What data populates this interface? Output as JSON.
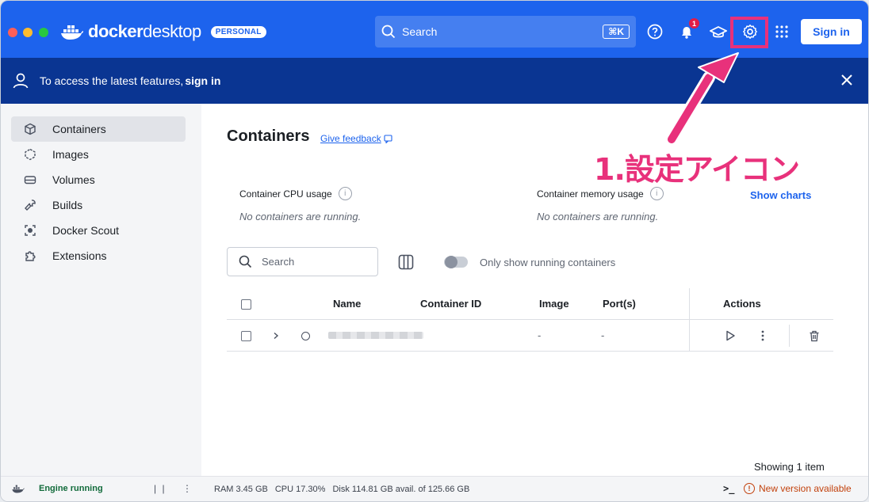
{
  "app": {
    "brand_main": "docker",
    "brand_light": "desktop",
    "plan_badge": "PERSONAL"
  },
  "topbar": {
    "search_placeholder": "Search",
    "search_shortcut": "⌘K",
    "notification_count": "1",
    "sign_in_label": "Sign in",
    "icons": [
      "help-icon",
      "bell-icon",
      "learning-center-icon",
      "settings-icon",
      "apps-grid-icon"
    ],
    "accent_color": "#1d63ed"
  },
  "banner": {
    "message": "To access the latest features,",
    "link": "sign in",
    "background": "#0a3592"
  },
  "sidebar": {
    "items": [
      {
        "label": "Containers",
        "icon": "containers-icon",
        "active": true
      },
      {
        "label": "Images",
        "icon": "images-icon"
      },
      {
        "label": "Volumes",
        "icon": "volumes-icon"
      },
      {
        "label": "Builds",
        "icon": "builds-icon"
      },
      {
        "label": "Docker Scout",
        "icon": "docker-scout-icon"
      },
      {
        "label": "Extensions",
        "icon": "extensions-icon"
      }
    ]
  },
  "main": {
    "title": "Containers",
    "feedback_link": "Give feedback",
    "annotation": "1.設定アイコン",
    "annotation_color": "#e8317b",
    "cpu_usage_label": "Container CPU usage",
    "cpu_usage_empty": "No containers are running.",
    "memory_usage_label": "Container memory usage",
    "memory_usage_empty": "No containers are running.",
    "show_charts": "Show charts",
    "search_placeholder": "Search",
    "toggle_label": "Only show running containers",
    "table": {
      "columns": [
        "Name",
        "Container ID",
        "Image",
        "Port(s)",
        "Actions"
      ],
      "rows": [
        {
          "name": "",
          "container_id": "",
          "image": "-",
          "ports": "-"
        }
      ]
    },
    "showing": "Showing 1 item"
  },
  "footer": {
    "engine_status": "Engine running",
    "ram": "RAM 3.45 GB",
    "cpu": "CPU 17.30%",
    "disk": "Disk 114.81 GB avail. of 125.66 GB",
    "terminal": ">_",
    "new_version": "New version available"
  }
}
